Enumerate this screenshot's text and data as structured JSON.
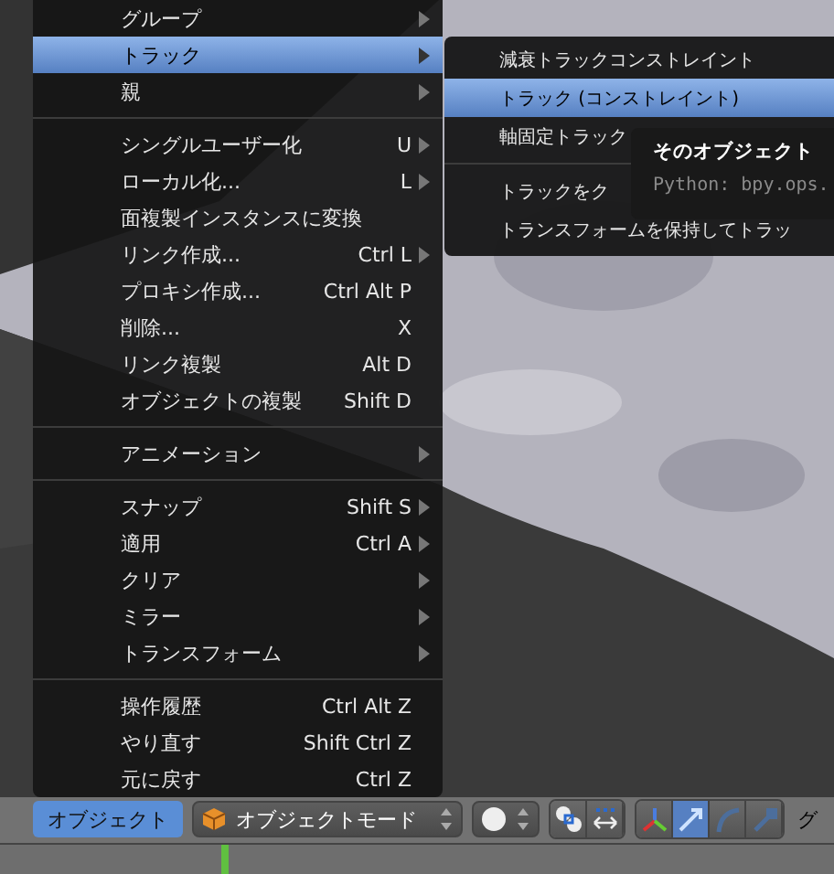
{
  "menu": {
    "items": [
      {
        "kind": "item",
        "label": "グループ",
        "submenu": true,
        "selected": false
      },
      {
        "kind": "item",
        "label": "トラック",
        "submenu": true,
        "selected": true
      },
      {
        "kind": "item",
        "label": "親",
        "submenu": true,
        "selected": false
      },
      {
        "kind": "separator"
      },
      {
        "kind": "item",
        "label": "シングルユーザー化",
        "shortcut": "U",
        "submenu": true,
        "selected": false
      },
      {
        "kind": "item",
        "label": "ローカル化...",
        "shortcut": "L",
        "submenu": true,
        "selected": false
      },
      {
        "kind": "item",
        "label": "面複製インスタンスに変換",
        "submenu": false,
        "selected": false
      },
      {
        "kind": "item",
        "label": "リンク作成...",
        "shortcut": "Ctrl L",
        "submenu": true,
        "selected": false
      },
      {
        "kind": "item",
        "label": "プロキシ作成...",
        "shortcut": "Ctrl Alt P",
        "submenu": false,
        "selected": false
      },
      {
        "kind": "item",
        "label": "削除...",
        "shortcut": "X",
        "submenu": false,
        "selected": false
      },
      {
        "kind": "item",
        "label": "リンク複製",
        "shortcut": "Alt D",
        "submenu": false,
        "selected": false
      },
      {
        "kind": "item",
        "label": "オブジェクトの複製",
        "shortcut": "Shift D",
        "submenu": false,
        "selected": false
      },
      {
        "kind": "separator"
      },
      {
        "kind": "item",
        "label": "アニメーション",
        "submenu": true,
        "selected": false
      },
      {
        "kind": "separator"
      },
      {
        "kind": "item",
        "label": "スナップ",
        "shortcut": "Shift S",
        "submenu": true,
        "selected": false
      },
      {
        "kind": "item",
        "label": "適用",
        "shortcut": "Ctrl A",
        "submenu": true,
        "selected": false
      },
      {
        "kind": "item",
        "label": "クリア",
        "submenu": true,
        "selected": false
      },
      {
        "kind": "item",
        "label": "ミラー",
        "submenu": true,
        "selected": false
      },
      {
        "kind": "item",
        "label": "トランスフォーム",
        "submenu": true,
        "selected": false
      },
      {
        "kind": "separator"
      },
      {
        "kind": "item",
        "label": "操作履歴",
        "shortcut": "Ctrl Alt Z",
        "submenu": false,
        "selected": false
      },
      {
        "kind": "item",
        "label": "やり直す",
        "shortcut": "Shift Ctrl Z",
        "submenu": false,
        "selected": false
      },
      {
        "kind": "item",
        "label": "元に戻す",
        "shortcut": "Ctrl Z",
        "submenu": false,
        "selected": false
      }
    ]
  },
  "submenu": {
    "items": [
      {
        "kind": "item",
        "label": "減衰トラックコンストレイント",
        "selected": false
      },
      {
        "kind": "item",
        "label": "トラック (コンストレイント)",
        "selected": true
      },
      {
        "kind": "item",
        "label": "軸固定トラック",
        "selected": false
      },
      {
        "kind": "separator"
      },
      {
        "kind": "item",
        "label": "トラックをク",
        "selected": false
      },
      {
        "kind": "item",
        "label": "トランスフォームを保持してトラッ",
        "selected": false
      }
    ]
  },
  "tooltip": {
    "title": "そのオブジェクト",
    "python": "Python: bpy.ops."
  },
  "header": {
    "object_menu": {
      "label": "オブジェクト",
      "selected": true
    },
    "mode": {
      "label": "オブジェクトモード"
    },
    "manipulators": [
      {
        "kind": "axes",
        "selected": false
      },
      {
        "kind": "translate",
        "selected": true
      },
      {
        "kind": "rotate",
        "selected": false
      },
      {
        "kind": "scale",
        "selected": false
      }
    ],
    "next_menu": "グ"
  }
}
